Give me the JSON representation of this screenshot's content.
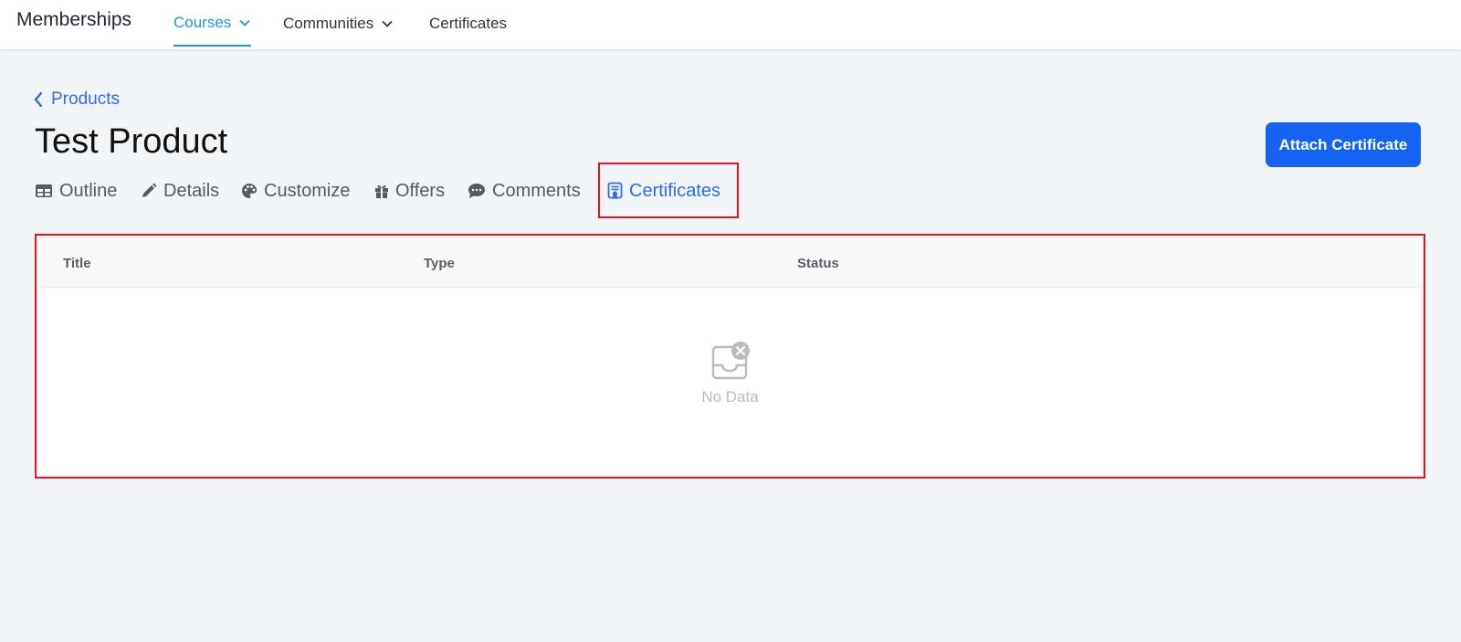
{
  "nav": {
    "brand": "Memberships",
    "items": [
      {
        "label": "Courses",
        "has_dropdown": true,
        "active": true
      },
      {
        "label": "Communities",
        "has_dropdown": true,
        "active": false
      },
      {
        "label": "Certificates",
        "has_dropdown": false,
        "active": false
      }
    ]
  },
  "breadcrumb": {
    "label": "Products"
  },
  "page": {
    "title": "Test Product",
    "attach_button": "Attach Certificate"
  },
  "tabs": [
    {
      "label": "Outline",
      "icon": "table-icon"
    },
    {
      "label": "Details",
      "icon": "pencil-icon"
    },
    {
      "label": "Customize",
      "icon": "palette-icon"
    },
    {
      "label": "Offers",
      "icon": "gift-icon"
    },
    {
      "label": "Comments",
      "icon": "comment-icon"
    },
    {
      "label": "Certificates",
      "icon": "certificate-icon",
      "active": true
    }
  ],
  "table": {
    "columns": [
      "Title",
      "Type",
      "Status"
    ],
    "rows": [],
    "empty_text": "No Data"
  },
  "colors": {
    "accent": "#2f6de3",
    "nav_active": "#1e9ad6",
    "primary_button": "#1463f3",
    "highlight_border": "#e5141a",
    "page_background": "#f1f5f8"
  }
}
